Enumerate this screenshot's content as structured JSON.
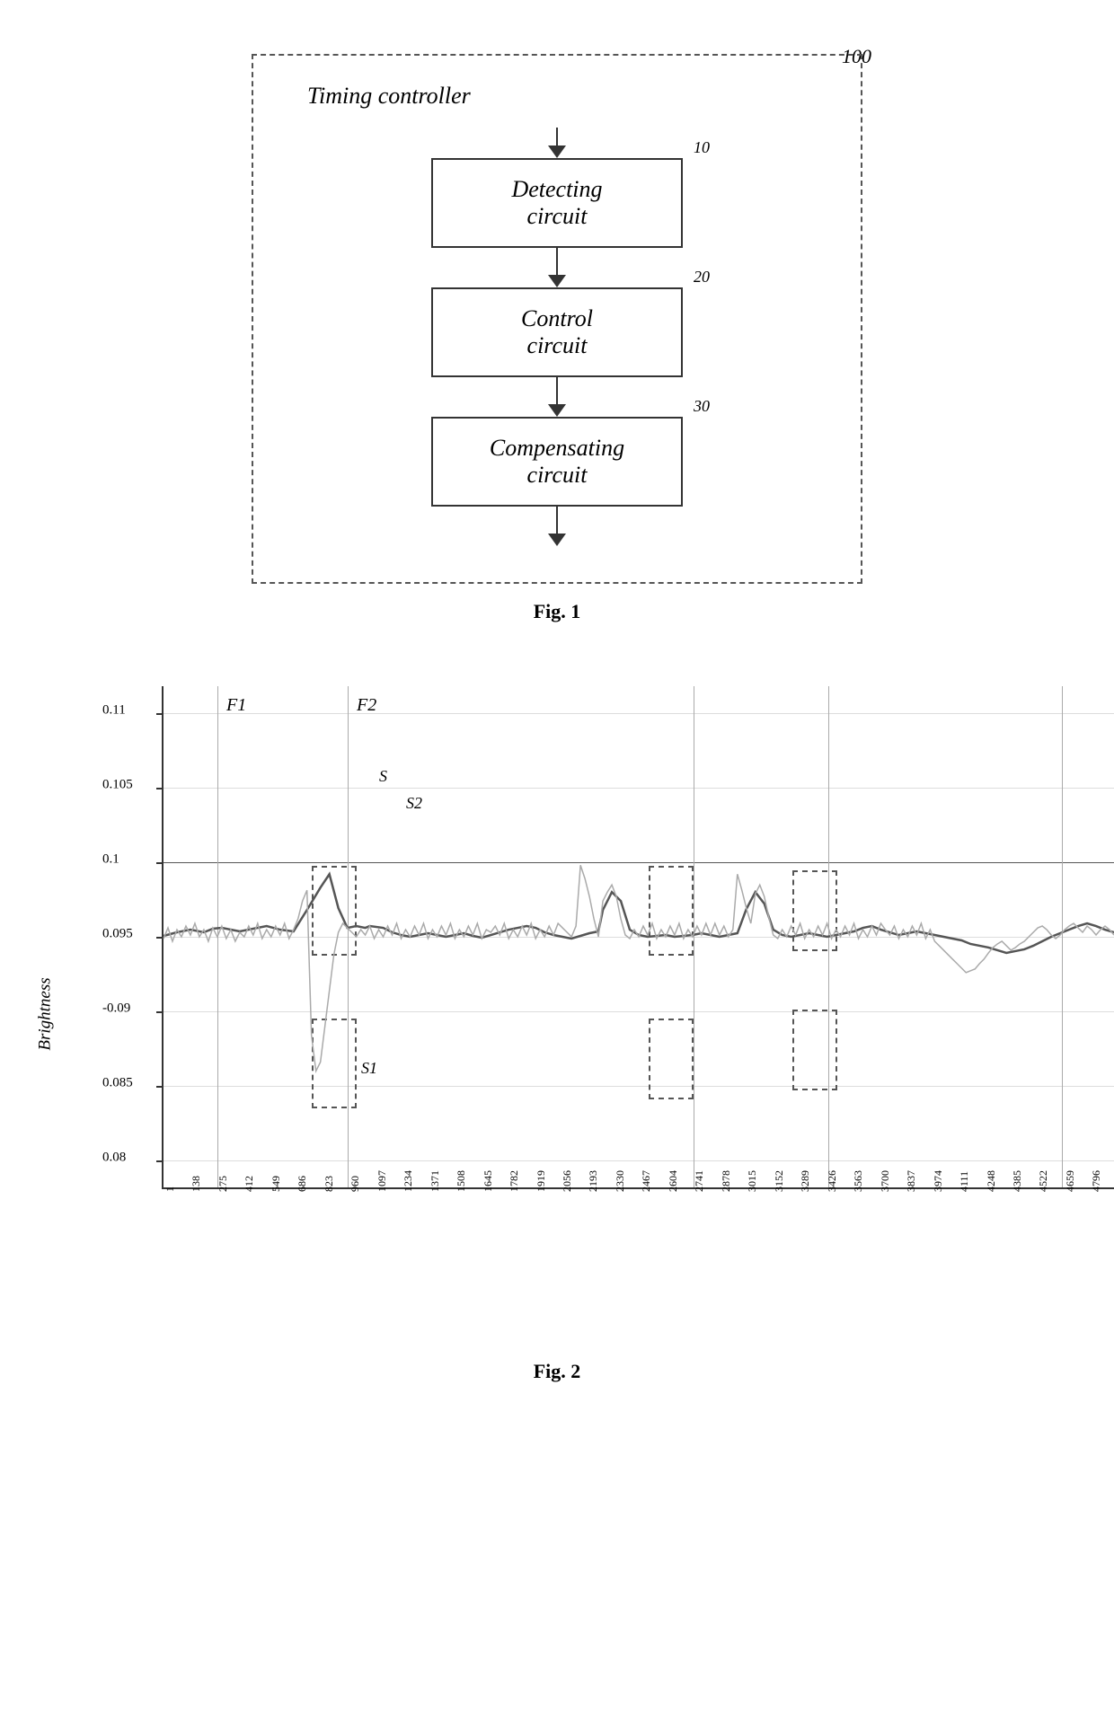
{
  "fig1": {
    "ref_number": "100",
    "title": "Timing controller",
    "blocks": [
      {
        "id": "10",
        "label": "Detecting\ncircuit"
      },
      {
        "id": "20",
        "label": "Control\ncircuit"
      },
      {
        "id": "30",
        "label": "Compensating\ncircuit"
      }
    ],
    "caption": "Fig. 1"
  },
  "fig2": {
    "caption": "Fig. 2",
    "y_axis_label": "Brightness",
    "y_ticks": [
      "0.11",
      "0.105",
      "0.1",
      "0.095",
      "0.09",
      "0.085",
      "0.08"
    ],
    "x_labels": [
      "1",
      "138",
      "275",
      "412",
      "549",
      "686",
      "823",
      "960",
      "1097",
      "1234",
      "1371",
      "1508",
      "1645",
      "1782",
      "1919",
      "2056",
      "2193",
      "2330",
      "2467",
      "2604",
      "2741",
      "2878",
      "3015",
      "3152",
      "3289",
      "3426",
      "3563",
      "3700",
      "3837",
      "3974",
      "4111",
      "4248",
      "4385",
      "4522",
      "4659",
      "4796"
    ],
    "frame_labels": [
      "F1",
      "F2"
    ],
    "series_labels": [
      "S",
      "S1",
      "S2"
    ]
  }
}
